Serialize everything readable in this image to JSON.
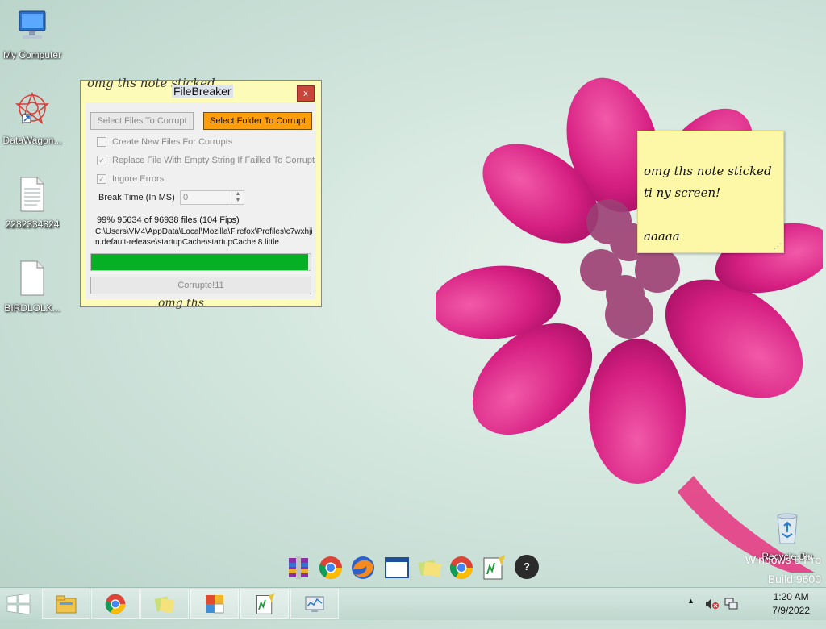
{
  "desktop": {
    "icons": [
      {
        "label": "My Computer"
      },
      {
        "label": "DataWagon..."
      },
      {
        "label": "2282334324"
      },
      {
        "label": "BIRDLOLX..."
      },
      {
        "label": "Recycle Bin"
      }
    ],
    "watermark": {
      "line1": "Windows 8 Pro",
      "line2": "Build 9600"
    }
  },
  "sticky_note": {
    "line1": "omg ths note sticked",
    "line2": "ti ny screen!",
    "line3": "aaaaa"
  },
  "filebreaker": {
    "title": "FileBreaker",
    "close_label": "x",
    "behind_text_top": "omg ths note sticked",
    "behind_text_bottom": "omg ths",
    "select_files_label": "Select Files To Corrupt",
    "select_folder_label": "Select Folder To Corrupt",
    "opt_create_new": "Create New Files For Corrupts",
    "opt_replace": "Replace File With Empty String If Failled To Corrupt",
    "opt_ignore": "Ingore Errors",
    "break_time_label": "Break Time (In MS)",
    "break_time_value": "0",
    "status": "99% 95634 of 96938 files (104 Fips)",
    "current_path": "C:\\Users\\VM4\\AppData\\Local\\Mozilla\\Firefox\\Profiles\\c7wxhjin.default-release\\startupCache\\startupCache.8.little",
    "progress_fraction": 0.99,
    "corrupt_button_label": "Corrupte!11",
    "colors": {
      "accent": "#ff9d0a",
      "progress": "#06b025"
    }
  },
  "dock": {
    "icons": [
      "winrar-icon",
      "chrome-icon",
      "firefox-icon",
      "window-icon",
      "folders-icon",
      "chrome-icon",
      "notepad-icon",
      "help-icon"
    ],
    "help_label": "?"
  },
  "taskbar": {
    "pinned": [
      "file-explorer-icon",
      "chrome-icon",
      "sticky-notes-icon",
      "control-panel-icon",
      "notepad-plus-icon",
      "task-manager-icon"
    ],
    "clock_time": "1:20 AM",
    "clock_date": "7/9/2022"
  }
}
